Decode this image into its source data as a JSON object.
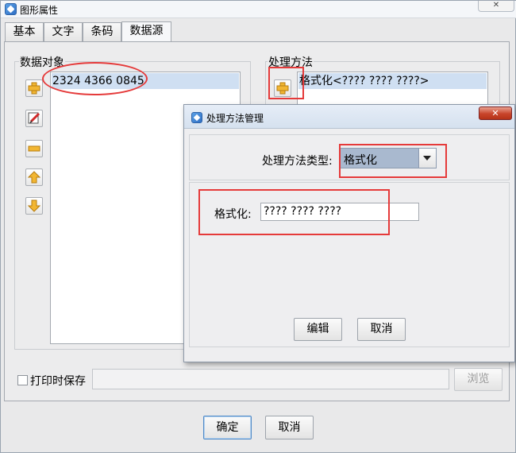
{
  "window": {
    "title": "图形属性",
    "close_symbol": "✕"
  },
  "tabs": [
    {
      "label": "基本",
      "active": false
    },
    {
      "label": "文字",
      "active": false
    },
    {
      "label": "条码",
      "active": false
    },
    {
      "label": "数据源",
      "active": true
    }
  ],
  "data_objects": {
    "label": "数据对象",
    "items": [
      "2324 4366 0845"
    ],
    "tools": [
      "add-icon",
      "edit-icon",
      "remove-icon",
      "move-up-icon",
      "move-down-icon"
    ]
  },
  "processing": {
    "label": "处理方法",
    "items": [
      "格式化<???? ???? ????>"
    ],
    "tools": [
      "add-icon",
      "edit-icon"
    ]
  },
  "save_on_print": {
    "label": "打印时保存",
    "checked": false,
    "path_value": "",
    "browse_label": "浏览"
  },
  "footer": {
    "ok_label": "确定",
    "cancel_label": "取消"
  },
  "dialog": {
    "title": "处理方法管理",
    "close_symbol": "✕",
    "type_label": "处理方法类型:",
    "type_value": "格式化",
    "format_label": "格式化:",
    "format_value": "???? ???? ????",
    "edit_label": "编辑",
    "cancel_label": "取消"
  },
  "colors": {
    "selection": "#cfdff2",
    "annotation_red": "#e53a3a",
    "icon_yellow": "#f2b632"
  }
}
